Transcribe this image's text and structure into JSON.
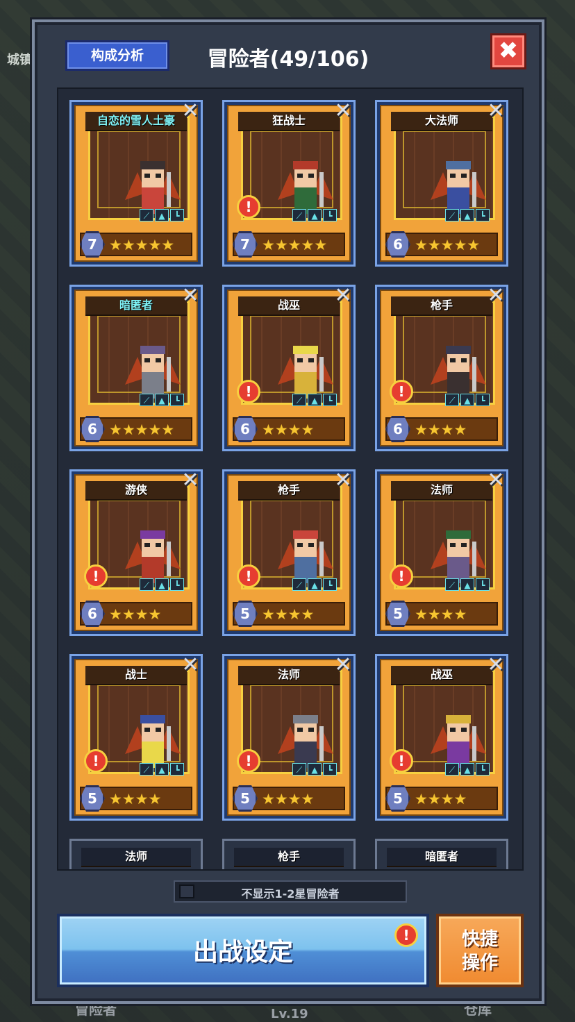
{
  "background": {
    "left_tag": "城镇",
    "bottom_left": "冒险者",
    "bottom_mid": "Lv.19",
    "bottom_right": "仓库"
  },
  "header": {
    "analysis_label": "构成分析",
    "title": "冒险者(49/106)",
    "close_symbol": "✖"
  },
  "cards": [
    {
      "name": "自恋的雪人土豪",
      "special": true,
      "level": "7",
      "stars": "★★★★★",
      "alert": false
    },
    {
      "name": "狂战士",
      "special": false,
      "level": "7",
      "stars": "★★★★★",
      "alert": true
    },
    {
      "name": "大法师",
      "special": false,
      "level": "6",
      "stars": "★★★★★",
      "alert": false
    },
    {
      "name": "暗匿者",
      "special": true,
      "level": "6",
      "stars": "★★★★★",
      "alert": false
    },
    {
      "name": "战巫",
      "special": false,
      "level": "6",
      "stars": "★★★★",
      "alert": true
    },
    {
      "name": "枪手",
      "special": false,
      "level": "6",
      "stars": "★★★★",
      "alert": true
    },
    {
      "name": "游侠",
      "special": false,
      "level": "6",
      "stars": "★★★★",
      "alert": true
    },
    {
      "name": "枪手",
      "special": false,
      "level": "5",
      "stars": "★★★★",
      "alert": true
    },
    {
      "name": "法师",
      "special": false,
      "level": "5",
      "stars": "★★★★",
      "alert": true
    },
    {
      "name": "战士",
      "special": false,
      "level": "5",
      "stars": "★★★★",
      "alert": true
    },
    {
      "name": "法师",
      "special": false,
      "level": "5",
      "stars": "★★★★",
      "alert": true
    },
    {
      "name": "战巫",
      "special": false,
      "level": "5",
      "stars": "★★★★",
      "alert": true
    }
  ],
  "partial_cards": [
    "法师",
    "枪手",
    "暗匿者"
  ],
  "filter_label": "不显示1-2星冒险者",
  "battle_button": "出战设定",
  "quick_button": [
    "快捷",
    "操作"
  ],
  "alert_symbol": "!",
  "swords_symbol": "✕",
  "equip_icons": [
    "⟋",
    "▲",
    "┗"
  ]
}
